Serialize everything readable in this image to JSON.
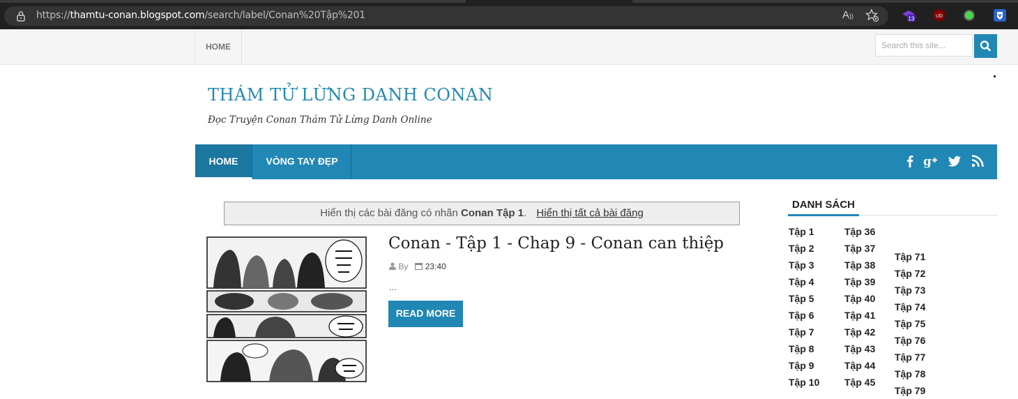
{
  "browser": {
    "url_prefix": "https://",
    "url_host": "thamtu-conan.blogspot.com",
    "url_path": "/search/label/Conan%20Tập%201",
    "extension_badge": "13",
    "extension_ud": "UD"
  },
  "topbar": {
    "home_label": "HOME",
    "search_placeholder": "Search this site..."
  },
  "header": {
    "title": "THÁM TỬ LỪNG DANH CONAN",
    "description": "Đọc Truyện Conan Thám Tử Lừng Danh Online"
  },
  "mainnav": {
    "items": [
      "HOME",
      "VÒNG TAY ĐẸP"
    ]
  },
  "notice": {
    "prefix": "Hiển thị các bài đăng có nhãn",
    "label": "Conan Tập 1",
    "dot": ".",
    "link": "Hiển thị tất cả bài đăng"
  },
  "post": {
    "title": "Conan - Tập 1 - Chap 9 - Conan can thiệp",
    "by": "By",
    "time": "23:40",
    "excerpt": "...",
    "read_more": "READ MORE"
  },
  "sidebar": {
    "title": "DANH SÁCH",
    "col1": [
      "Tập 1",
      "Tập 2",
      "Tập 3",
      "Tập 4",
      "Tập 5",
      "Tập 6",
      "Tập 7",
      "Tập 8",
      "Tập 9",
      "Tập 10"
    ],
    "col2": [
      "Tập 36",
      "Tập 37",
      "Tập 38",
      "Tập 39",
      "Tập 40",
      "Tập 41",
      "Tập 42",
      "Tập 43",
      "Tập 44",
      "Tập 45"
    ],
    "col3": [
      "Tập 71",
      "Tập 72",
      "Tập 73",
      "Tập 74",
      "Tập 75",
      "Tập 76",
      "Tập 77",
      "Tập 78",
      "Tập 79"
    ]
  },
  "colors": {
    "accent": "#2187b5",
    "browser_bg": "#202020"
  }
}
